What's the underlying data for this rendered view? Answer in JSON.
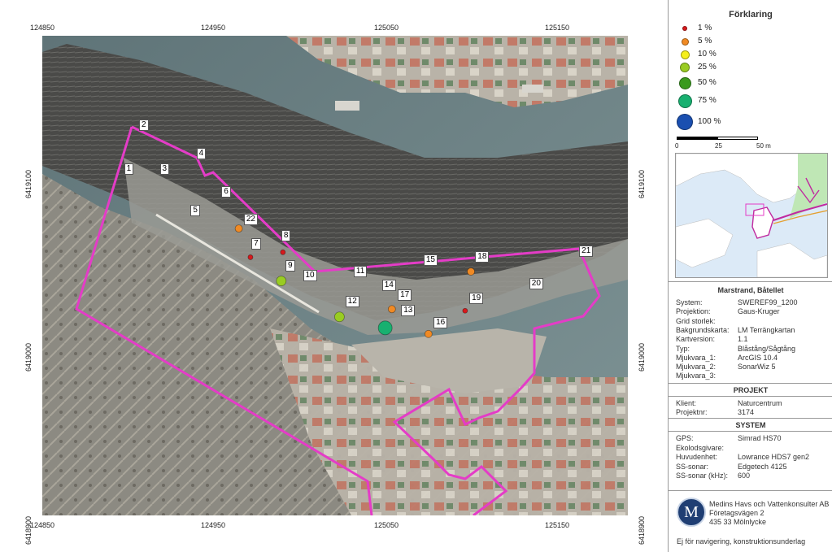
{
  "map": {
    "x_ticks": [
      "124850",
      "124950",
      "125050",
      "125150"
    ],
    "y_ticks": [
      "6419100",
      "6419000",
      "6418900"
    ],
    "points": [
      {
        "id": "1",
        "x": 0.155,
        "y": 0.307
      },
      {
        "id": "2",
        "x": 0.173,
        "y": 0.227
      },
      {
        "id": "3",
        "x": 0.198,
        "y": 0.307
      },
      {
        "id": "4",
        "x": 0.242,
        "y": 0.278
      },
      {
        "id": "5",
        "x": 0.235,
        "y": 0.382
      },
      {
        "id": "6",
        "x": 0.272,
        "y": 0.347
      },
      {
        "id": "7",
        "x": 0.308,
        "y": 0.442
      },
      {
        "id": "8",
        "x": 0.344,
        "y": 0.427
      },
      {
        "id": "9",
        "x": 0.349,
        "y": 0.481
      },
      {
        "id": "10",
        "x": 0.37,
        "y": 0.499
      },
      {
        "id": "11",
        "x": 0.431,
        "y": 0.492
      },
      {
        "id": "12",
        "x": 0.421,
        "y": 0.546
      },
      {
        "id": "13",
        "x": 0.488,
        "y": 0.563
      },
      {
        "id": "14",
        "x": 0.465,
        "y": 0.517
      },
      {
        "id": "15",
        "x": 0.515,
        "y": 0.472
      },
      {
        "id": "16",
        "x": 0.527,
        "y": 0.584
      },
      {
        "id": "17",
        "x": 0.484,
        "y": 0.535
      },
      {
        "id": "18",
        "x": 0.577,
        "y": 0.465
      },
      {
        "id": "19",
        "x": 0.57,
        "y": 0.541
      },
      {
        "id": "20",
        "x": 0.642,
        "y": 0.514
      },
      {
        "id": "21",
        "x": 0.702,
        "y": 0.455
      },
      {
        "id": "22",
        "x": 0.299,
        "y": 0.398
      }
    ],
    "markers": [
      {
        "level": "5 %",
        "x": 0.287,
        "y": 0.414
      },
      {
        "level": "1 %",
        "x": 0.301,
        "y": 0.466
      },
      {
        "level": "1 %",
        "x": 0.34,
        "y": 0.457
      },
      {
        "level": "25 %",
        "x": 0.338,
        "y": 0.509
      },
      {
        "level": "25 %",
        "x": 0.408,
        "y": 0.574
      },
      {
        "level": "75 %",
        "x": 0.463,
        "y": 0.594
      },
      {
        "level": "5 %",
        "x": 0.471,
        "y": 0.56
      },
      {
        "level": "5 %",
        "x": 0.515,
        "y": 0.605
      },
      {
        "level": "5 %",
        "x": 0.566,
        "y": 0.492
      },
      {
        "level": "1 %",
        "x": 0.559,
        "y": 0.563
      }
    ]
  },
  "legend": {
    "title": "Förklaring",
    "items": [
      {
        "label": "1 %",
        "color": "#d7191c"
      },
      {
        "label": "5 %",
        "color": "#f08a24"
      },
      {
        "label": "10 %",
        "color": "#f5ef1c"
      },
      {
        "label": "25 %",
        "color": "#99cc22"
      },
      {
        "label": "50 %",
        "color": "#3a9a1f"
      },
      {
        "label": "75 %",
        "color": "#18b070"
      },
      {
        "label": "100 %",
        "color": "#1a4fb0"
      }
    ],
    "scale_labels": [
      "0",
      "25",
      "50 m"
    ]
  },
  "info": {
    "project_title": "Marstrand, Båtellet",
    "rows": [
      {
        "k": "System:",
        "v": "SWEREF99_1200"
      },
      {
        "k": "Projektion:",
        "v": "Gaus-Kruger"
      },
      {
        "k": "Grid storlek:",
        "v": ""
      },
      {
        "k": "Bakgrundskarta:",
        "v": "LM Terrängkartan"
      },
      {
        "k": "Kartversion:",
        "v": "1.1"
      },
      {
        "k": "Typ:",
        "v": "Blåstång/Sågtång"
      },
      {
        "k": "Mjukvara_1:",
        "v": "ArcGIS 10.4"
      },
      {
        "k": "Mjukvara_2:",
        "v": "SonarWiz 5"
      },
      {
        "k": "Mjukvara_3:",
        "v": ""
      }
    ],
    "projekt_title": "PROJEKT",
    "projekt_rows": [
      {
        "k": "Klient:",
        "v": "Naturcentrum"
      },
      {
        "k": "Projektnr:",
        "v": "3174"
      }
    ],
    "system_title": "SYSTEM",
    "system_rows": [
      {
        "k": "GPS:",
        "v": "Simrad HS70"
      },
      {
        "k": "Ekolodsgivare:",
        "v": ""
      },
      {
        "k": "Huvudenhet:",
        "v": "Lowrance HDS7 gen2"
      },
      {
        "k": "SS-sonar:",
        "v": "Edgetech 4125"
      },
      {
        "k": "SS-sonar (kHz):",
        "v": "600"
      }
    ],
    "company_name": "Medins Havs och Vattenkonsulter AB",
    "company_address1": "Företagsvägen 2",
    "company_address2": "435 33 Mölnlycke",
    "footer_note": "Ej för navigering, konstruktionsunderlag"
  },
  "colors": {
    "boundary": "#e43cc7"
  }
}
